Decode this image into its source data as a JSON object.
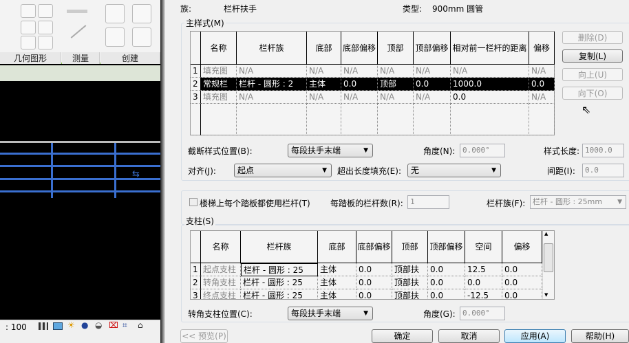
{
  "ribbon": {
    "panels": [
      "几何图形",
      "测量",
      "创建"
    ]
  },
  "status": {
    "scale": ": 100"
  },
  "dialog": {
    "family_label": "族:",
    "family_value": "栏杆扶手",
    "type_label": "类型:",
    "type_value": "900mm 圆管",
    "main_pattern": {
      "title": "主样式(M)",
      "columns": [
        "名称",
        "栏杆族",
        "底部",
        "底部偏移",
        "顶部",
        "顶部偏移",
        "相对前一栏杆的距离",
        "偏移"
      ],
      "rows": [
        {
          "num": "1",
          "cells": [
            "填充图",
            "N/A",
            "N/A",
            "N/A",
            "N/A",
            "N/A",
            "N/A",
            "N/A"
          ],
          "state": "disabled"
        },
        {
          "num": "2",
          "cells": [
            "常规栏",
            "栏杆 - 圆形 : 2",
            "主体",
            "0.0",
            "顶部",
            "0.0",
            "1000.0",
            "0.0"
          ],
          "state": "selected"
        },
        {
          "num": "3",
          "cells": [
            "填充图",
            "N/A",
            "N/A",
            "N/A",
            "N/A",
            "N/A",
            "0.0",
            "N/A"
          ],
          "state": "disabled"
        }
      ],
      "buttons": {
        "delete": "删除(D)",
        "copy": "复制(L)",
        "up": "向上(U)",
        "down": "向下(O)"
      },
      "break_label": "截断样式位置(B):",
      "break_value": "每段扶手末端",
      "angle_label": "角度(N):",
      "angle_value": "0.000°",
      "pattern_length_label": "样式长度:",
      "pattern_length_value": "1000.0",
      "justify_label": "对齐(J):",
      "justify_value": "起点",
      "excess_label": "超出长度填充(E):",
      "excess_value": "无",
      "spacing_label": "间距(I):",
      "spacing_value": "0.0"
    },
    "treads": {
      "checkbox_label": "楼梯上每个踏板都使用栏杆(T)",
      "checked": false,
      "per_tread_label": "每踏板的栏杆数(R):",
      "per_tread_value": "1",
      "baluster_family_label": "栏杆族(F):",
      "baluster_family_value": "栏杆 - 圆形 : 25mm"
    },
    "posts": {
      "title": "支柱(S)",
      "columns": [
        "名称",
        "栏杆族",
        "底部",
        "底部偏移",
        "顶部",
        "顶部偏移",
        "空间",
        "偏移"
      ],
      "rows": [
        {
          "num": "1",
          "cells": [
            "起点支柱",
            "栏杆 - 圆形 : 25",
            "主体",
            "0.0",
            "顶部扶",
            "0.0",
            "12.5",
            "0.0"
          ]
        },
        {
          "num": "2",
          "cells": [
            "转角支柱",
            "栏杆 - 圆形 : 25",
            "主体",
            "0.0",
            "顶部扶",
            "0.0",
            "0.0",
            "0.0"
          ]
        },
        {
          "num": "3",
          "cells": [
            "终点支柱",
            "栏杆 - 圆形 : 25",
            "主体",
            "0.0",
            "顶部扶",
            "0.0",
            "-12.5",
            "0.0"
          ]
        }
      ],
      "corner_label": "转角支柱位置(C):",
      "corner_value": "每段扶手末端",
      "angle_label": "角度(G):",
      "angle_value": "0.000°"
    },
    "footer": {
      "preview": "<< 预览(P)",
      "ok": "确定",
      "cancel": "取消",
      "apply": "应用(A)",
      "help": "帮助(H)"
    }
  }
}
